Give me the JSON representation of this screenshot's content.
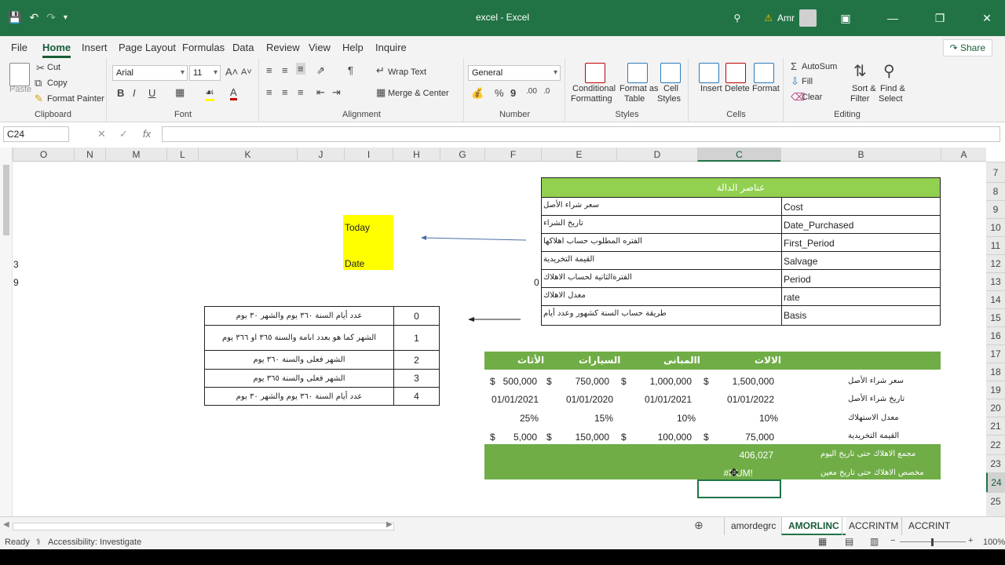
{
  "titlebar": {
    "title": "excel  -  Excel",
    "user": "Amr"
  },
  "tabs": [
    "File",
    "Home",
    "Insert",
    "Page Layout",
    "Formulas",
    "Data",
    "Review",
    "View",
    "Help",
    "Inquire"
  ],
  "share_label": "Share",
  "ribbon": {
    "clipboard": {
      "paste": "Paste",
      "cut": "Cut",
      "copy": "Copy",
      "format_painter": "Format Painter",
      "label": "Clipboard"
    },
    "font": {
      "name": "Arial",
      "size": "11",
      "label": "Font"
    },
    "alignment": {
      "wrap": "Wrap Text",
      "merge": "Merge & Center",
      "label": "Alignment"
    },
    "number": {
      "format": "General",
      "label": "Number"
    },
    "styles": {
      "cond": "Conditional Formatting",
      "cond1": "Conditional",
      "cond2": "Formatting",
      "fmt_table1": "Format as",
      "fmt_table2": "Table",
      "cell_styles1": "Cell",
      "cell_styles2": "Styles",
      "label": "Styles"
    },
    "cells": {
      "insert": "Insert",
      "delete": "Delete",
      "format": "Format",
      "label": "Cells"
    },
    "editing": {
      "autosum": "AutoSum",
      "fill": "Fill",
      "clear": "Clear",
      "sort1": "Sort &",
      "sort2": "Filter",
      "find1": "Find &",
      "find2": "Select",
      "label": "Editing"
    }
  },
  "formula_bar": {
    "name_box": "C24",
    "fx": "fx",
    "value": ""
  },
  "columns": [
    "O",
    "N",
    "M",
    "L",
    "K",
    "J",
    "I",
    "H",
    "G",
    "F",
    "E",
    "D",
    "C",
    "B",
    "A"
  ],
  "rows": [
    "7",
    "8",
    "9",
    "10",
    "11",
    "12",
    "13",
    "14",
    "15",
    "16",
    "17",
    "18",
    "19",
    "20",
    "21",
    "22",
    "23",
    "24",
    "25"
  ],
  "left_edge": [
    "3",
    "9"
  ],
  "yellow_box": {
    "line1": "Today",
    "line2": "Date"
  },
  "zero_marker": "0",
  "elements_table": {
    "header": "عناصر الدالة",
    "rows": [
      {
        "ar": "سعر شراء الأصل",
        "en": "Cost"
      },
      {
        "ar": "تاريخ الشراء",
        "en": "Date_Purchased"
      },
      {
        "ar": "الفتره المطلوب حساب اهلاكها",
        "en": "First_Period"
      },
      {
        "ar": "القيمة التخريدية",
        "en": "Salvage"
      },
      {
        "ar": "الفترةالثانية لحساب الاهلاك",
        "en": "Period"
      },
      {
        "ar": "معدل الاهلاك",
        "en": "rate"
      },
      {
        "ar": "طريقة حساب السنة كشهور وعدد أيام",
        "en": "Basis"
      }
    ]
  },
  "basis_table": [
    {
      "num": "0",
      "ar": "عدد أيام السنة ٣٦٠ يوم والشهر ٣٠ يوم"
    },
    {
      "num": "1",
      "ar": "الشهر كما هو بعدد اىامة والسنة ٣٦٥ او ٣٦٦ يوم"
    },
    {
      "num": "2",
      "ar": "الشهر فعلى والسنة ٣٦٠ يوم"
    },
    {
      "num": "3",
      "ar": "الشهر فعلى والسنة ٣٦٥ يوم"
    },
    {
      "num": "4",
      "ar": "عدد أيام السنة ٣٦٠ يوم والشهر ٣٠ يوم"
    }
  ],
  "assets": {
    "headers": [
      "الالات",
      "االمبانى",
      "السيارات",
      "الأثاث"
    ],
    "row_labels": [
      "سعر شراء الأصل",
      "تاريخ شراء الأصل",
      "معدل الاستهلاك",
      "القيمة التخريدية",
      "مجمع الاهلاك حتى تاريخ اليوم",
      "مخصص الاهلاك حتى تاريخ معين"
    ],
    "currency": "$",
    "cost": [
      "1,500,000",
      "1,000,000",
      "750,000",
      "500,000"
    ],
    "date": [
      "01/01/2022",
      "01/01/2021",
      "01/01/2020",
      "01/01/2021"
    ],
    "rate": [
      "10%",
      "10%",
      "15%",
      "25%"
    ],
    "salvage": [
      "75,000",
      "100,000",
      "150,000",
      "5,000"
    ],
    "accum": "406,027",
    "alloc": "#NUM!"
  },
  "sheets": [
    "amordegrc",
    "AMORLINC",
    "ACCRINTM",
    "ACCRINT"
  ],
  "active_sheet": "AMORLINC",
  "status": {
    "ready": "Ready",
    "accessibility": "Accessibility: Investigate",
    "zoom": "100%"
  },
  "colors": {
    "excel_green": "#217346",
    "header_green": "#92d050",
    "asset_green": "#70ad47",
    "yellow": "#ffff00"
  }
}
